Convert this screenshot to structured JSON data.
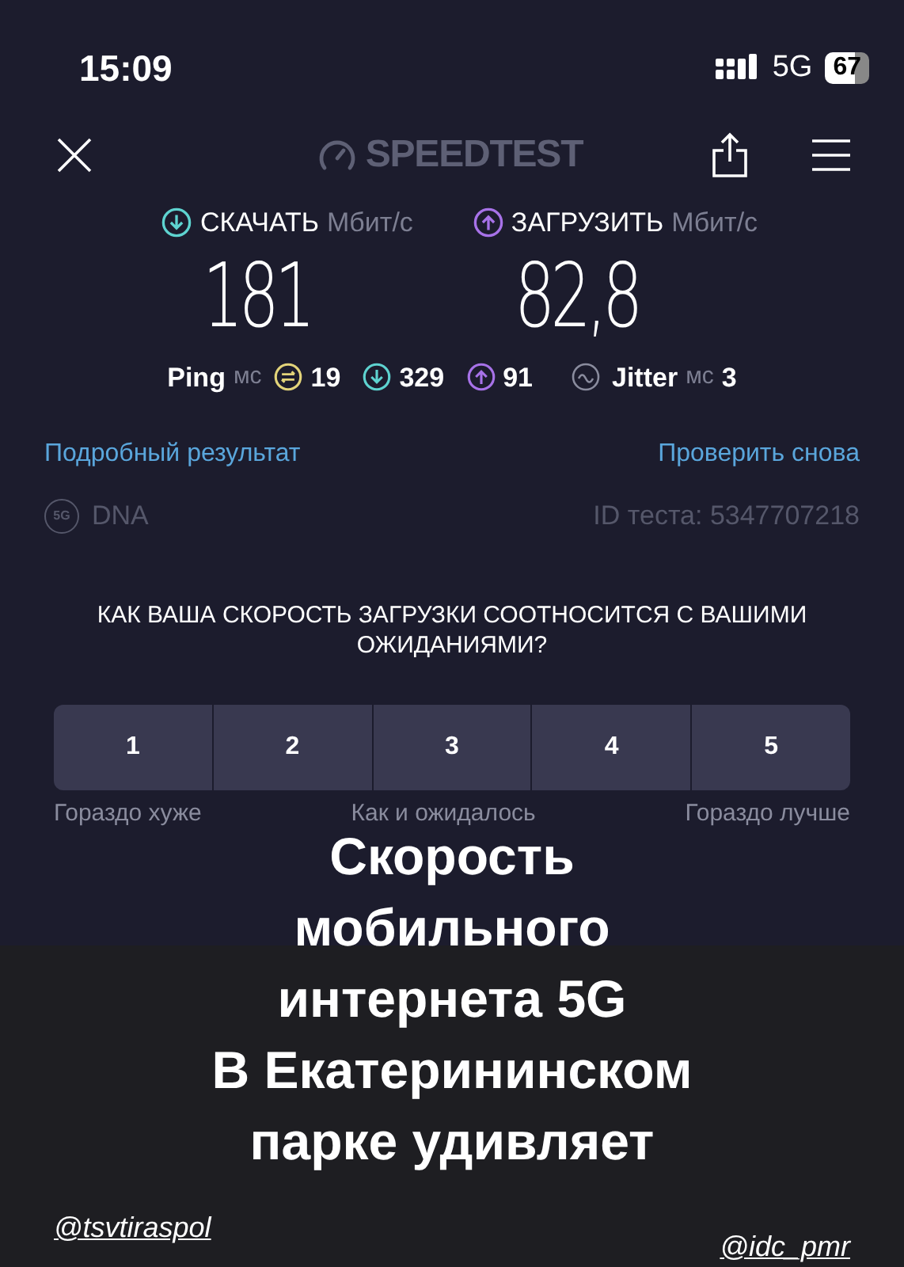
{
  "status_bar": {
    "time": "15:09",
    "network": "5G",
    "battery": "67"
  },
  "header": {
    "logo": "SPEEDTEST"
  },
  "results": [
    {
      "kind": "download",
      "label": "СКАЧАТЬ",
      "unit": "Мбит/с",
      "value": "181"
    },
    {
      "kind": "upload",
      "label": "ЗАГРУЗИТЬ",
      "unit": "Мбит/с",
      "value": "82,8"
    }
  ],
  "ping": {
    "label": "Ping",
    "unit": "мс",
    "items": [
      {
        "kind": "idle",
        "value": "19"
      },
      {
        "kind": "download",
        "value": "329"
      },
      {
        "kind": "upload",
        "value": "91"
      }
    ]
  },
  "jitter": {
    "label": "Jitter",
    "unit": "мс",
    "value": "3"
  },
  "links": [
    "Подробный результат",
    "Проверить снова"
  ],
  "provider": {
    "badge": "5G",
    "name": "DNA",
    "test_id": "ID теста: 5347707218"
  },
  "survey": {
    "question": "КАК ВАША СКОРОСТЬ ЗАГРУЗКИ СООТНОСИТСЯ С ВАШИМИ ОЖИДАНИЯМИ?",
    "options": [
      {
        "label": "1",
        "selected": false
      },
      {
        "label": "2",
        "selected": false
      },
      {
        "label": "3",
        "selected": false
      },
      {
        "label": "4",
        "selected": false
      },
      {
        "label": "5",
        "selected": false
      }
    ],
    "scale_labels": [
      "Гораздо хуже",
      "Как и ожидалось",
      "Гораздо лучше"
    ]
  },
  "caption": [
    "Скорость",
    "мобильного",
    "интернета 5G",
    "В Екатерининском",
    "парке удивляет"
  ],
  "mentions": [
    "@tsvtiraspol",
    "@idc_pmr"
  ]
}
